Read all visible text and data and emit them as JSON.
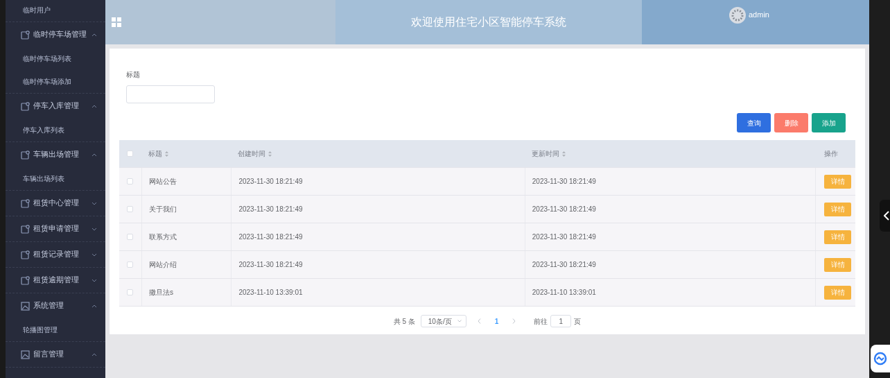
{
  "sidebar": {
    "items": [
      {
        "kind": "sub",
        "label": "临时用户"
      },
      {
        "kind": "group",
        "label": "临时停车场管理",
        "expanded": true,
        "children": [
          {
            "label": "临时停车场列表"
          },
          {
            "label": "临时停车场添加"
          }
        ]
      },
      {
        "kind": "group",
        "label": "停车入库管理",
        "expanded": true,
        "children": [
          {
            "label": "停车入库列表"
          }
        ]
      },
      {
        "kind": "group",
        "label": "车辆出场管理",
        "expanded": true,
        "children": [
          {
            "label": "车辆出场列表"
          }
        ]
      },
      {
        "kind": "group",
        "label": "租赁中心管理",
        "expanded": false
      },
      {
        "kind": "group",
        "label": "租赁申请管理",
        "expanded": false
      },
      {
        "kind": "group",
        "label": "租赁记录管理",
        "expanded": false
      },
      {
        "kind": "group",
        "label": "租赁逾期管理",
        "expanded": false
      },
      {
        "kind": "image_group",
        "label": "系统管理",
        "expanded": true,
        "children": [
          {
            "label": "轮播图管理"
          }
        ]
      },
      {
        "kind": "image_group",
        "label": "留言管理",
        "expanded": true
      }
    ]
  },
  "header": {
    "title": "欢迎使用住宅小区智能停车系统",
    "user": "admin"
  },
  "search": {
    "label": "标题"
  },
  "buttons": [
    {
      "label": "查询",
      "kind": "primary"
    },
    {
      "label": "删除",
      "kind": "danger"
    },
    {
      "label": "添加",
      "kind": "success"
    }
  ],
  "table": {
    "all_checked": false,
    "columns": [
      {
        "label": "标题",
        "sortable": true
      },
      {
        "label": "创建时间",
        "sortable": true
      },
      {
        "label": "更新时间",
        "sortable": true
      },
      {
        "label": "操作",
        "sortable": false
      }
    ],
    "rows": [
      {
        "checked": false,
        "cells": [
          "网站公告",
          "2023-11-30 18:21:49",
          "2023-11-30 18:21:49"
        ],
        "action": "详情"
      },
      {
        "checked": false,
        "cells": [
          "关于我们",
          "2023-11-30 18:21:49",
          "2023-11-30 18:21:49"
        ],
        "action": "详情"
      },
      {
        "checked": false,
        "cells": [
          "联系方式",
          "2023-11-30 18:21:49",
          "2023-11-30 18:21:49"
        ],
        "action": "详情"
      },
      {
        "checked": false,
        "cells": [
          "网站介绍",
          "2023-11-30 18:21:49",
          "2023-11-30 18:21:49"
        ],
        "action": "详情"
      },
      {
        "checked": false,
        "cells": [
          "撒旦法s",
          "2023-11-10 13:39:01",
          "2023-11-10 13:39:01"
        ],
        "action": "详情"
      }
    ]
  },
  "pagination": {
    "total": "共 5 条",
    "page_size": "10条/页",
    "pages": [
      {
        "label": "1",
        "selected": true
      }
    ],
    "goto_label": "前往",
    "goto_value": "1",
    "goto_suffix": "页"
  }
}
